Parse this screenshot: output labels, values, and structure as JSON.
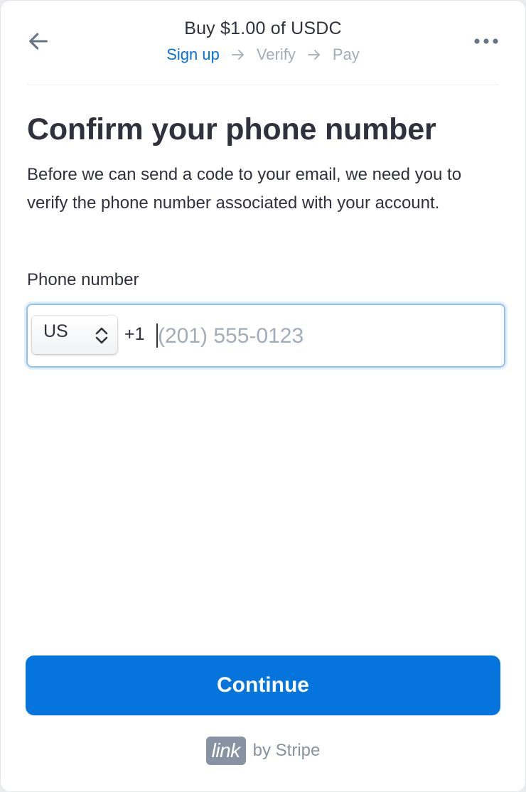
{
  "header": {
    "title": "Buy $1.00 of USDC",
    "back_icon": "arrow-left-icon",
    "more_icon": "more-horizontal-icon",
    "steps": [
      {
        "label": "Sign up",
        "state": "active"
      },
      {
        "label": "Verify",
        "state": "upcoming"
      },
      {
        "label": "Pay",
        "state": "upcoming"
      }
    ]
  },
  "main": {
    "title": "Confirm your phone number",
    "description": "Before we can send a code to your email, we need you to verify the phone number associated with your account.",
    "phone": {
      "label": "Phone number",
      "country": "US",
      "dial_code": "+1",
      "value": "",
      "placeholder": "(201) 555-0123"
    }
  },
  "actions": {
    "continue_label": "Continue"
  },
  "footer": {
    "logo_text": "link",
    "by_text": "by Stripe"
  },
  "colors": {
    "accent": "#0570de",
    "button": "#0574dd",
    "text": "#30313d",
    "muted": "#a3acb9",
    "logo_bg": "#8792a2"
  }
}
